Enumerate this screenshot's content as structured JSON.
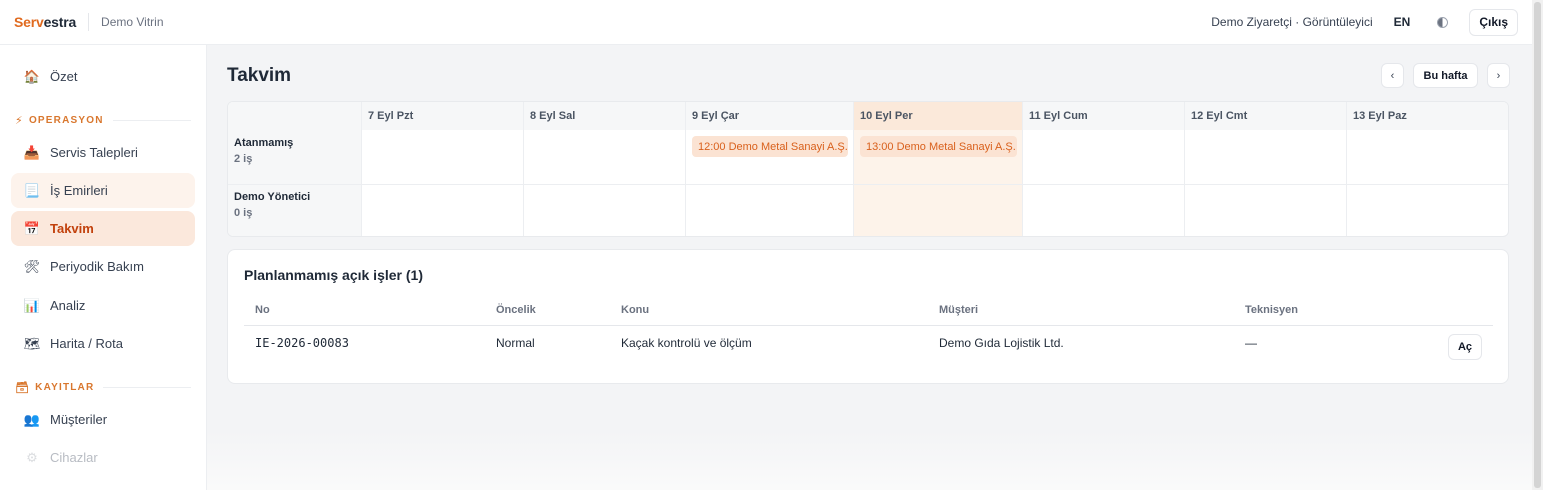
{
  "app": {
    "brand_part1": "Serv",
    "brand_part2": "estra",
    "workspace": "Demo Vitrin"
  },
  "header": {
    "user_label": "Demo Ziyaretçi · Görüntüleyici",
    "lang": "EN",
    "theme_icon": "half-moon-icon",
    "logout": "Çıkış"
  },
  "sidebar": {
    "overview": {
      "label": "Özet",
      "icon": "house-icon"
    },
    "section_operations": "OPERASYON",
    "service_requests": {
      "label": "Servis Talepleri",
      "icon": "inbox-icon"
    },
    "work_orders": {
      "label": "İş Emirleri",
      "icon": "receipt-icon"
    },
    "calendar": {
      "label": "Takvim",
      "icon": "calendar-icon"
    },
    "periodic": {
      "label": "Periyodik Bakım",
      "icon": "tools-icon"
    },
    "analysis": {
      "label": "Analiz",
      "icon": "bar-chart-icon"
    },
    "map": {
      "label": "Harita / Rota",
      "icon": "map-icon"
    },
    "section_records": "KAYITLAR",
    "customers": {
      "label": "Müşteriler",
      "icon": "people-icon"
    },
    "devices": {
      "label": "Cihazlar",
      "icon": "gear-icon"
    }
  },
  "calendar": {
    "title": "Takvim",
    "prev": "‹",
    "today": "Bu hafta",
    "next": "›",
    "days": [
      "7 Eyl Pzt",
      "8 Eyl Sal",
      "9 Eyl Çar",
      "10 Eyl Per",
      "11 Eyl Cum",
      "12 Eyl Cmt",
      "13 Eyl Paz"
    ],
    "rows": [
      {
        "name": "Atanmamış",
        "count": "2 iş"
      },
      {
        "name": "Demo Yönetici",
        "count": "0 iş"
      }
    ],
    "events": [
      {
        "label": "12:00 Demo Metal Sanayi A.Ş."
      },
      {
        "label": "13:00 Demo Metal Sanayi A.Ş."
      }
    ]
  },
  "unplanned": {
    "title": "Planlanmamış açık işler (1)",
    "headers": {
      "no": "No",
      "priority": "Öncelik",
      "subject": "Konu",
      "customer": "Müşteri",
      "technician": "Teknisyen"
    },
    "row": {
      "no": "IE-2026-00083",
      "priority": "Normal",
      "subject": "Kaçak kontrolü ve ölçüm",
      "customer": "Demo Gıda Lojistik Ltd.",
      "technician": "—",
      "open": "Aç"
    }
  },
  "colors": {
    "accent": "#e06a1f",
    "active_bg": "#fbe8dc",
    "event_bg": "#fbe3d3",
    "today_col": "#fdf3ea"
  }
}
